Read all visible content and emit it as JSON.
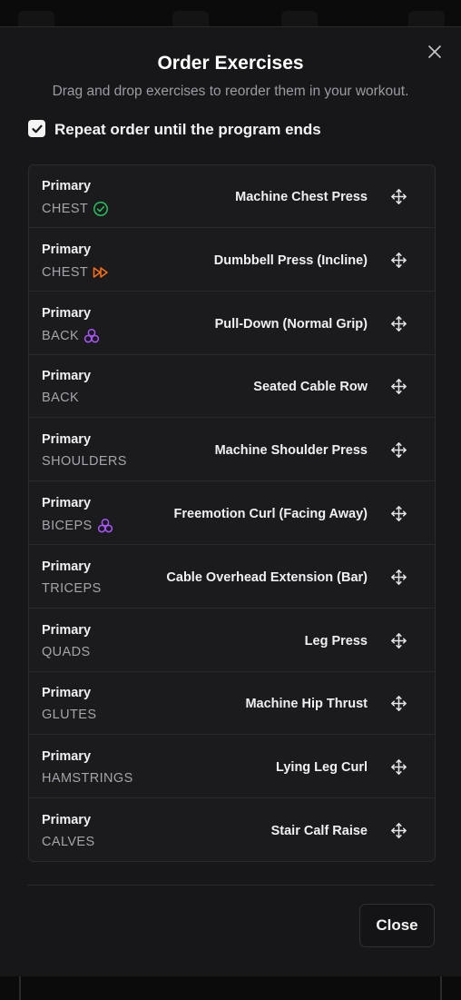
{
  "modal": {
    "title": "Order Exercises",
    "subtitle": "Drag and drop exercises to reorder them in your workout.",
    "repeat_checkbox": {
      "label": "Repeat order until the program ends",
      "checked": true
    },
    "close_button_label": "Close"
  },
  "colors": {
    "completed_icon": "#22c55e",
    "skip_icon": "#f97316",
    "superset_icon": "#a855f7"
  },
  "exercises": [
    {
      "category": "Primary",
      "muscle": "CHEST",
      "name": "Machine Chest Press",
      "status_icon": "check-circle-icon"
    },
    {
      "category": "Primary",
      "muscle": "CHEST",
      "name": "Dumbbell Press (Incline)",
      "status_icon": "fast-forward-icon"
    },
    {
      "category": "Primary",
      "muscle": "BACK",
      "name": "Pull-Down (Normal Grip)",
      "status_icon": "superset-icon"
    },
    {
      "category": "Primary",
      "muscle": "BACK",
      "name": "Seated Cable Row",
      "status_icon": null
    },
    {
      "category": "Primary",
      "muscle": "SHOULDERS",
      "name": "Machine Shoulder Press",
      "status_icon": null
    },
    {
      "category": "Primary",
      "muscle": "BICEPS",
      "name": "Freemotion Curl (Facing Away)",
      "status_icon": "superset-icon"
    },
    {
      "category": "Primary",
      "muscle": "TRICEPS",
      "name": "Cable Overhead Extension (Bar)",
      "status_icon": null
    },
    {
      "category": "Primary",
      "muscle": "QUADS",
      "name": "Leg Press",
      "status_icon": null
    },
    {
      "category": "Primary",
      "muscle": "GLUTES",
      "name": "Machine Hip Thrust",
      "status_icon": null
    },
    {
      "category": "Primary",
      "muscle": "HAMSTRINGS",
      "name": "Lying Leg Curl",
      "status_icon": null
    },
    {
      "category": "Primary",
      "muscle": "CALVES",
      "name": "Stair Calf Raise",
      "status_icon": null
    }
  ]
}
